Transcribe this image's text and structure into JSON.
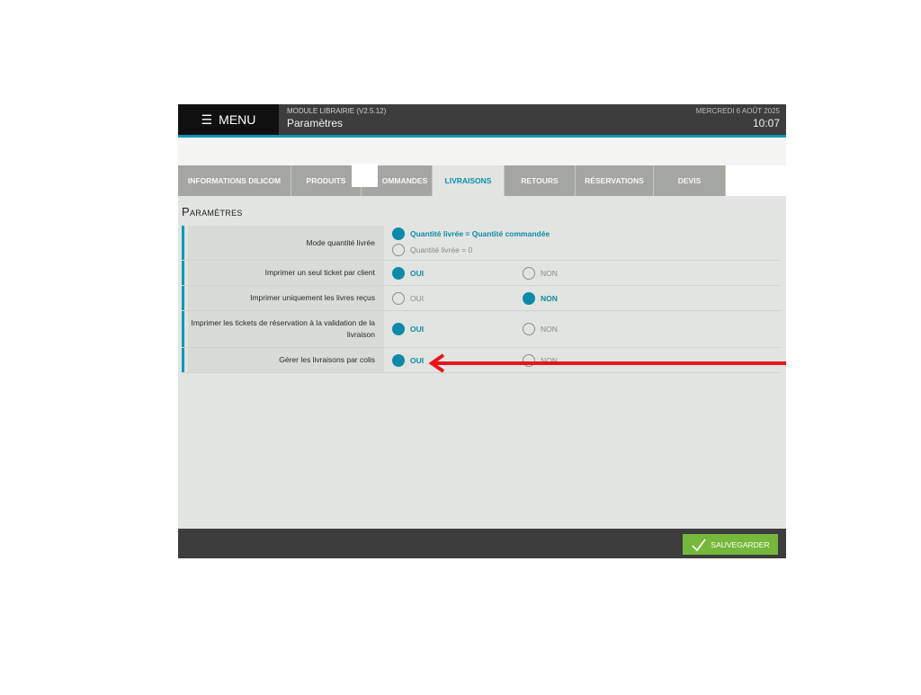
{
  "header": {
    "menu_label": "MENU",
    "menu_icon": "hamburger-icon",
    "module": "MODULE LIBRAIRIE (V2.5.12)",
    "page": "Paramètres",
    "date": "MERCREDI 6 AOÛT 2025",
    "time": "10:07"
  },
  "tabs": [
    {
      "label": "INFORMATIONS DILICOM",
      "active": false
    },
    {
      "label": "PRODUITS",
      "active": false
    },
    {
      "label": "OMMANDES",
      "active": false
    },
    {
      "label": "LIVRAISONS",
      "active": true
    },
    {
      "label": "RETOURS",
      "active": false
    },
    {
      "label": "RÉSERVATIONS",
      "active": false
    },
    {
      "label": "DEVIS",
      "active": false
    }
  ],
  "section": {
    "title": "Paramètres"
  },
  "settings": [
    {
      "label": "Mode quantité livrée",
      "options": [
        {
          "label": "Quantité livrée = Quantité commandée",
          "selected": true
        },
        {
          "label": "Quantité livrée = 0",
          "selected": false
        }
      ]
    },
    {
      "label": "Imprimer un seul ticket par client",
      "options": [
        {
          "label": "OUI",
          "selected": true
        },
        {
          "label": "NON",
          "selected": false
        }
      ]
    },
    {
      "label": "Imprimer uniquement les livres reçus",
      "options": [
        {
          "label": "OUI",
          "selected": false
        },
        {
          "label": "NON",
          "selected": true
        }
      ]
    },
    {
      "label": "Imprimer les tickets de réservation à la validation de la livraison",
      "options": [
        {
          "label": "OUI",
          "selected": true
        },
        {
          "label": "NON",
          "selected": false
        }
      ]
    },
    {
      "label": "Gérer les livraisons par colis",
      "options": [
        {
          "label": "OUI",
          "selected": true
        },
        {
          "label": "NON",
          "selected": false
        }
      ]
    }
  ],
  "footer": {
    "save_label": "SAUVEGARDER",
    "save_icon": "check-icon"
  },
  "colors": {
    "accent": "#0e8aa8",
    "header_bg": "#3d3d3d",
    "save_button": "#76b83b",
    "annotation_arrow": "#e8141c"
  }
}
